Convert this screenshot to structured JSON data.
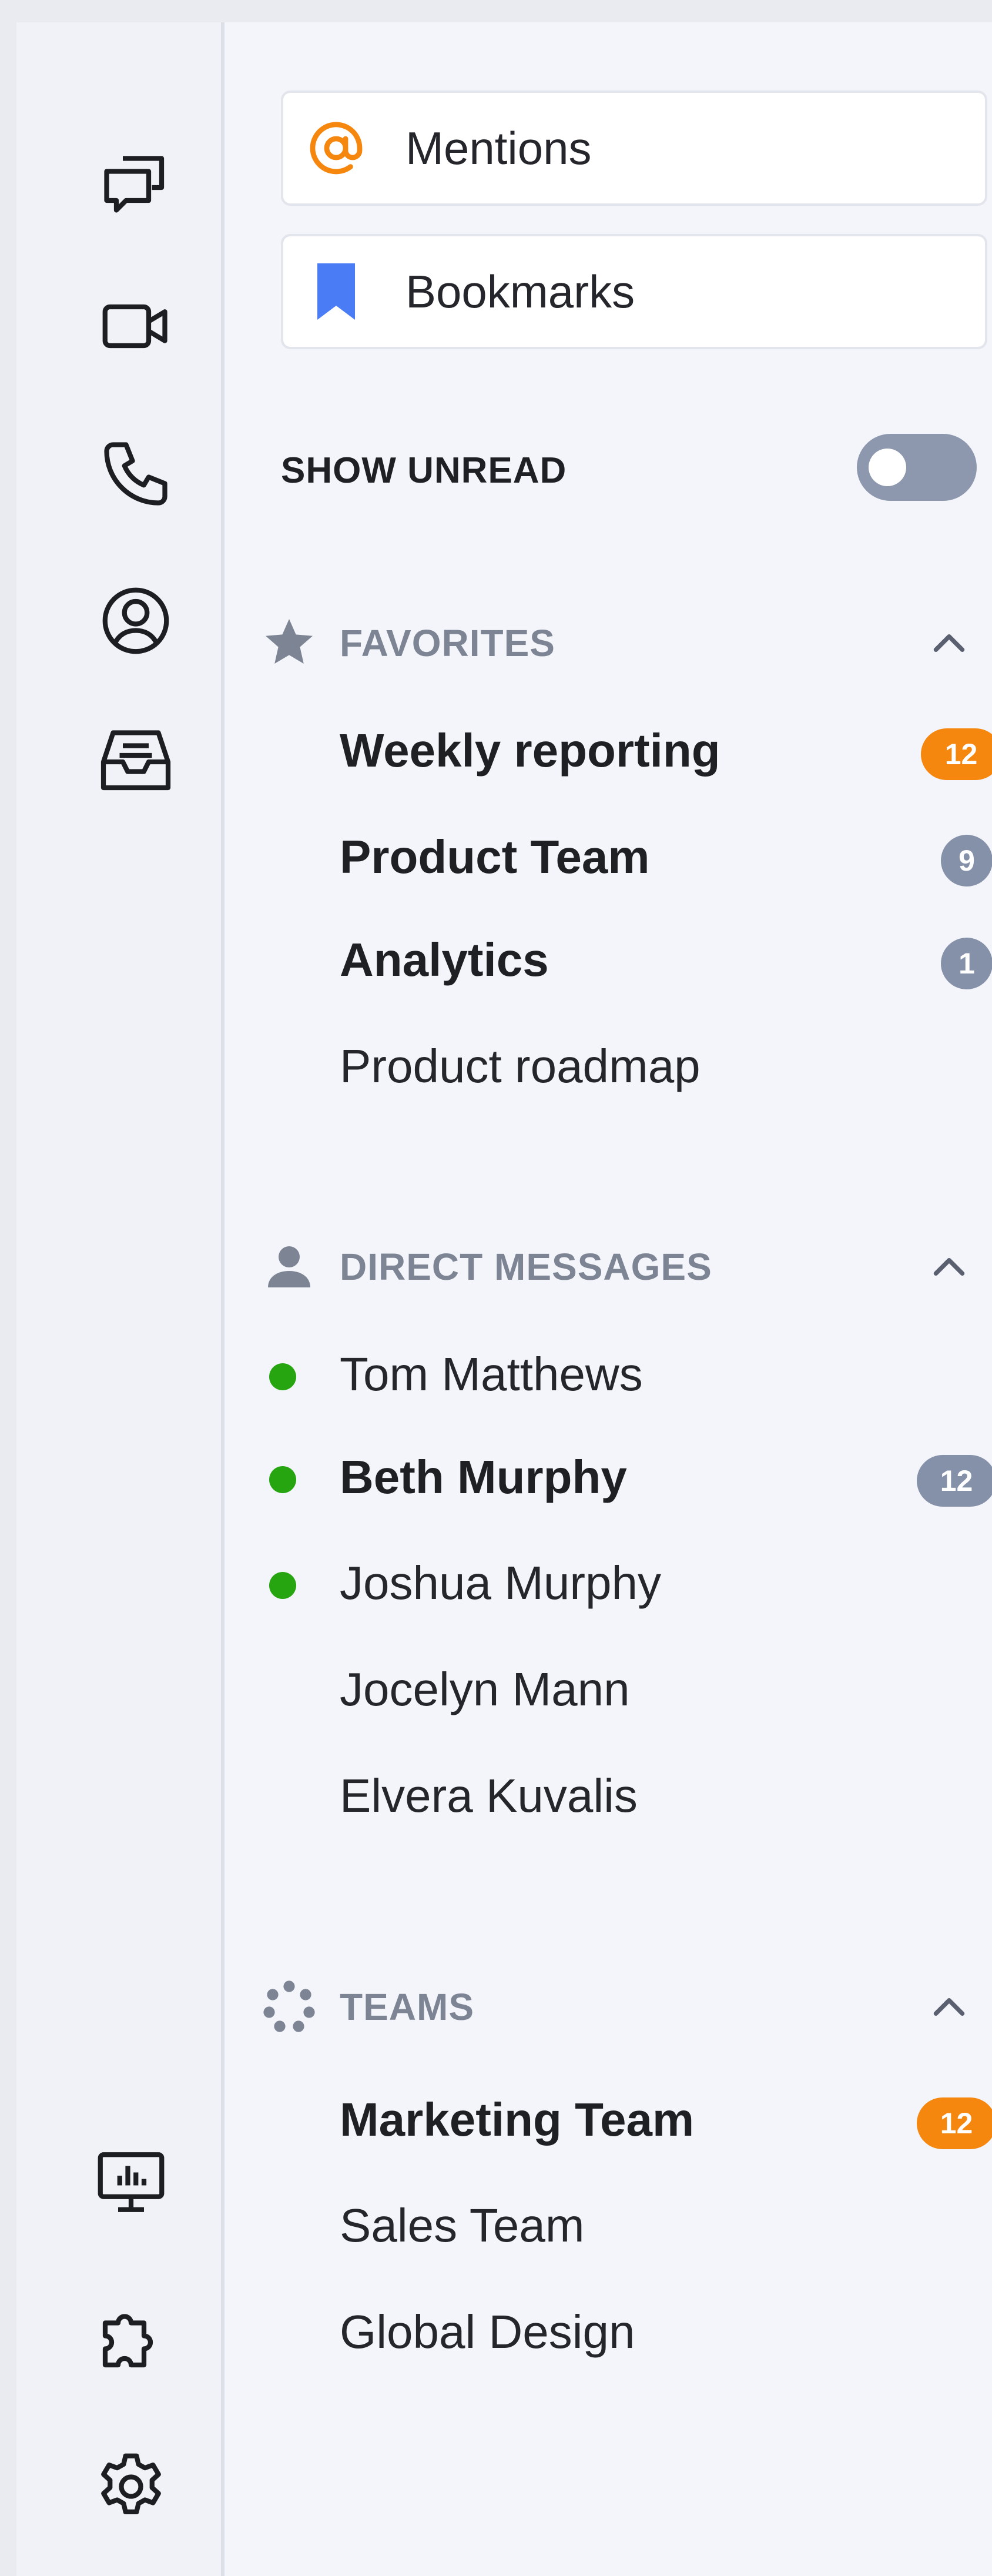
{
  "rail": {
    "top_items": [
      {
        "name": "chat-bubbles-icon"
      },
      {
        "name": "video-camera-icon"
      },
      {
        "name": "phone-icon"
      },
      {
        "name": "user-circle-icon"
      },
      {
        "name": "inbox-tray-icon"
      }
    ],
    "bottom_items": [
      {
        "name": "monitor-chart-icon"
      },
      {
        "name": "puzzle-piece-icon"
      },
      {
        "name": "gear-icon"
      }
    ]
  },
  "quick_links": {
    "mentions": {
      "label": "Mentions",
      "icon": "at-sign-icon",
      "color": "#f5870f"
    },
    "bookmarks": {
      "label": "Bookmarks",
      "icon": "bookmark-icon",
      "color": "#4a7cf6"
    }
  },
  "show_unread": {
    "label": "SHOW UNREAD",
    "enabled": false
  },
  "favorites": {
    "title": "FAVORITES",
    "icon": "star-icon",
    "expanded": true,
    "items": [
      {
        "label": "Weekly reporting",
        "unread": true,
        "badge": "12",
        "badge_color": "orange"
      },
      {
        "label": "Product Team",
        "unread": true,
        "badge": "9",
        "badge_color": "gray"
      },
      {
        "label": "Analytics",
        "unread": true,
        "badge": "1",
        "badge_color": "gray"
      },
      {
        "label": "Product roadmap",
        "unread": false,
        "badge": null
      }
    ]
  },
  "direct_messages": {
    "title": "DIRECT MESSAGES",
    "icon": "person-icon",
    "expanded": true,
    "items": [
      {
        "label": "Tom Matthews",
        "online": true,
        "unread": false,
        "badge": null
      },
      {
        "label": "Beth Murphy",
        "online": true,
        "unread": true,
        "badge": "12",
        "badge_color": "gray"
      },
      {
        "label": "Joshua Murphy",
        "online": true,
        "unread": false,
        "badge": null
      },
      {
        "label": "Jocelyn Mann",
        "online": false,
        "unread": false,
        "badge": null
      },
      {
        "label": "Elvera Kuvalis",
        "online": false,
        "unread": false,
        "badge": null
      }
    ]
  },
  "teams": {
    "title": "TEAMS",
    "icon": "teams-dots-icon",
    "expanded": true,
    "items": [
      {
        "label": "Marketing Team",
        "unread": true,
        "badge": "12",
        "badge_color": "orange"
      },
      {
        "label": "Sales Team",
        "unread": false,
        "badge": null
      },
      {
        "label": "Global Design",
        "unread": false,
        "badge": null
      }
    ]
  },
  "colors": {
    "accent_orange": "#f5870f",
    "badge_gray": "#8591a9",
    "online_green": "#26a510",
    "section_title_gray": "#7d8494",
    "bookmark_blue": "#4a7cf6"
  }
}
